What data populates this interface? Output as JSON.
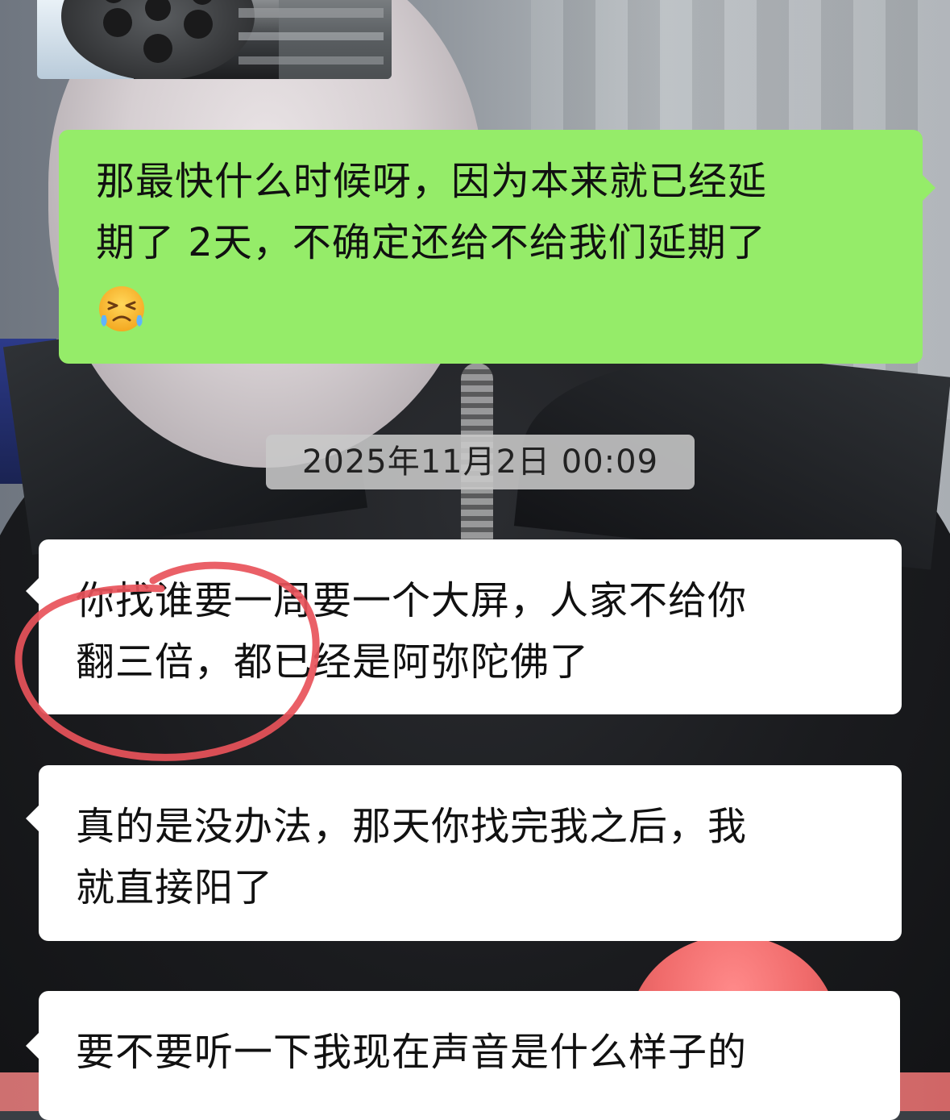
{
  "messages": [
    {
      "direction": "sent",
      "lines": [
        "那最快什么时候呀，因为本来就已经延",
        "期了 2天，不确定还给不给我们延期了"
      ],
      "emoji": "crying-emoji"
    },
    {
      "direction": "received",
      "lines": [
        "你找谁要一周要一个大屏，人家不给你",
        "翻三倍，都已经是阿弥陀佛了"
      ]
    },
    {
      "direction": "received",
      "lines": [
        "真的是没办法，那天你找完我之后，我",
        "就直接阳了"
      ]
    },
    {
      "direction": "received",
      "lines": [
        "要不要听一下我现在声音是什么样子的"
      ]
    }
  ],
  "timestamp": "2025年11月2日 00:09",
  "colors": {
    "sent_bubble": "#95ec69",
    "received_bubble": "#ffffff",
    "annotation_circle": "#e8535a",
    "timestamp_pill": "#c8c8c8"
  },
  "icons": {
    "shared_image": "minigun-image-thumbnail",
    "emoji": "loudly-crying-face"
  }
}
